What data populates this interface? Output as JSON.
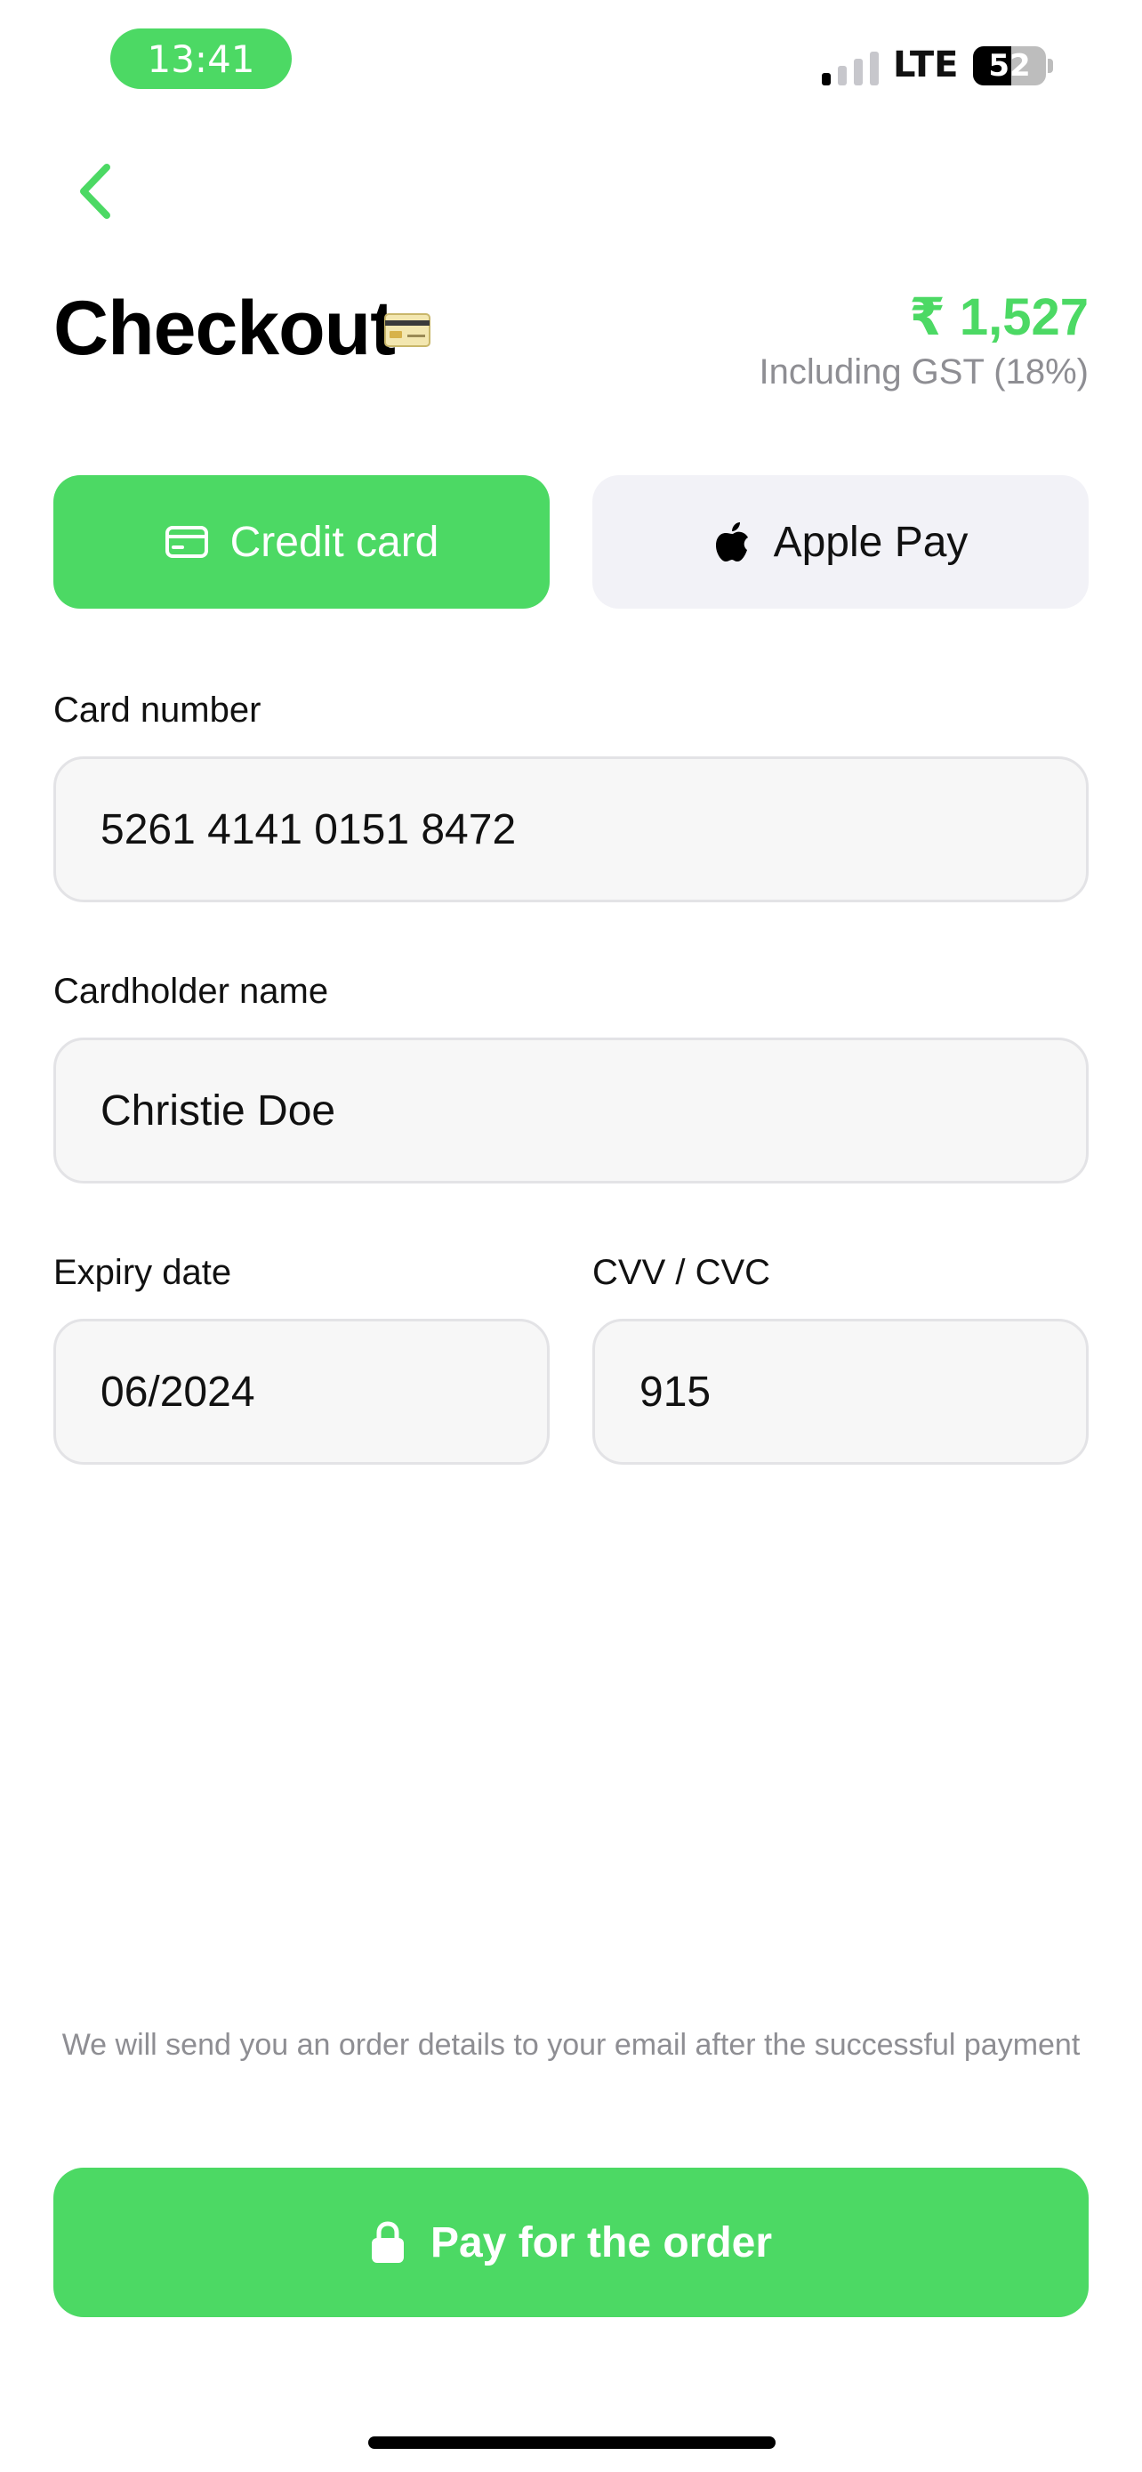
{
  "status_bar": {
    "time": "13:41",
    "network": "LTE",
    "battery": "52",
    "signal_bars_active": 1,
    "signal_bars_total": 4
  },
  "header": {
    "back_icon": "chevron-left-icon",
    "title": "Checkout",
    "title_icon": "credit-card-emoji",
    "price": "₹ 1,527",
    "price_note": "Including GST (18%)"
  },
  "payment_methods": [
    {
      "label": "Credit card",
      "icon": "credit-card-icon",
      "selected": true
    },
    {
      "label": "Apple Pay",
      "icon": "apple-logo-icon",
      "selected": false
    }
  ],
  "form": {
    "card_number": {
      "label": "Card number",
      "value": "5261 4141 0151 8472"
    },
    "cardholder_name": {
      "label": "Cardholder name",
      "value": "Christie Doe"
    },
    "expiry_date": {
      "label": "Expiry date",
      "value": "06/2024"
    },
    "cvv": {
      "label": "CVV / CVC",
      "value": "915"
    }
  },
  "footer": {
    "note": "We will send you an order details to your email after the successful payment",
    "pay_button": "Pay for the order",
    "pay_icon": "lock-icon"
  },
  "colors": {
    "accent": "#4cd964",
    "inactive_tab": "#f2f2f7",
    "field_bg": "#f7f7f7",
    "field_border": "#e3e3e6",
    "muted_text": "#8e8e93"
  }
}
